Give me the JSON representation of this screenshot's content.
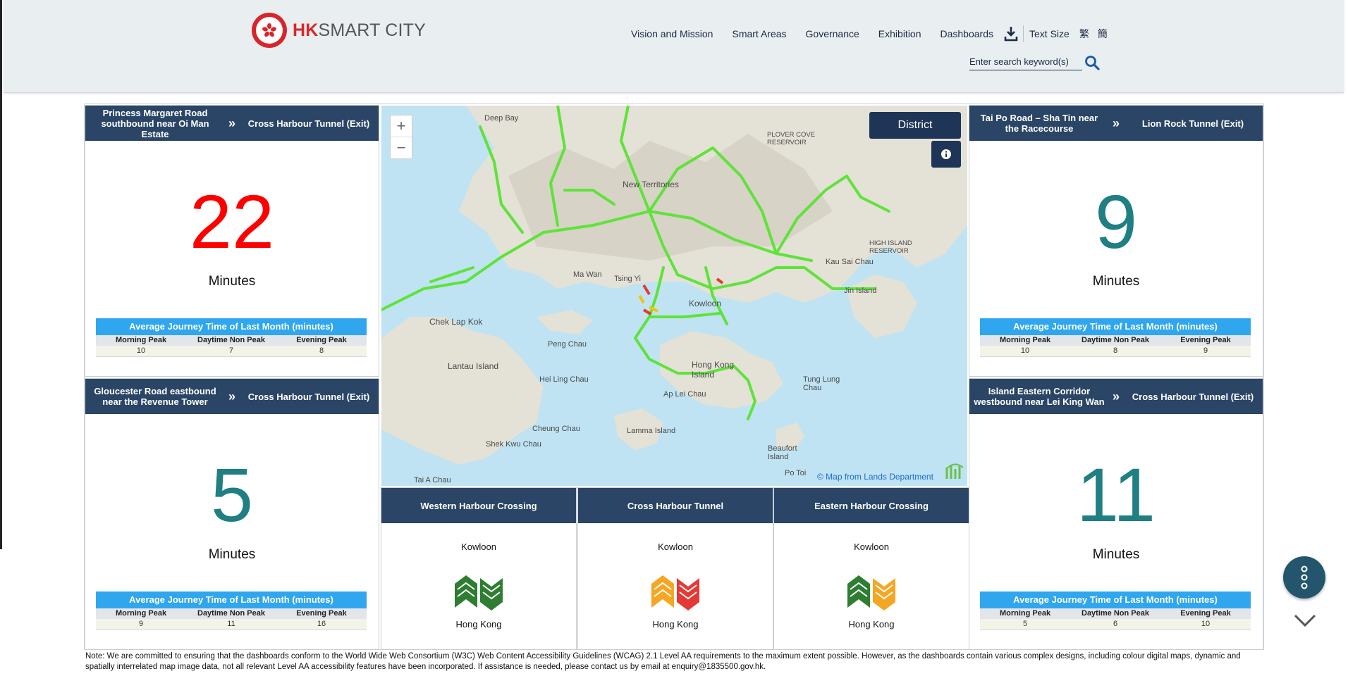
{
  "header": {
    "logo_hk": "HK",
    "logo_rest": "SMART CITY",
    "nav": [
      "Vision and Mission",
      "Smart Areas",
      "Governance",
      "Exhibition",
      "Dashboards"
    ],
    "text_size": "Text Size",
    "lang_trad": "繁",
    "lang_simp": "簡",
    "search_placeholder": "Enter search keyword(s)"
  },
  "avg_title": "Average Journey Time of Last Month (minutes)",
  "avg_cols": [
    "Morning Peak",
    "Daytime Non Peak",
    "Evening Peak"
  ],
  "minutes_label": "Minutes",
  "routes": [
    {
      "from": "Princess Margaret Road southbound near Oi Man Estate",
      "to": "Cross Harbour Tunnel (Exit)",
      "minutes": "22",
      "color": "#ff0000",
      "avg": [
        "10",
        "7",
        "8"
      ]
    },
    {
      "from": "Tai Po Road – Sha Tin near the Racecourse",
      "to": "Lion Rock Tunnel (Exit)",
      "minutes": "9",
      "color": "#1f7f82",
      "avg": [
        "10",
        "8",
        "9"
      ]
    },
    {
      "from": "Gloucester Road eastbound near the Revenue Tower",
      "to": "Cross Harbour Tunnel (Exit)",
      "minutes": "5",
      "color": "#1f7f82",
      "avg": [
        "9",
        "11",
        "16"
      ]
    },
    {
      "from": "Island Eastern Corridor westbound near Lei King Wan",
      "to": "Cross Harbour Tunnel (Exit)",
      "minutes": "11",
      "color": "#1f7f82",
      "avg": [
        "5",
        "6",
        "10"
      ]
    }
  ],
  "map": {
    "district_button": "District",
    "attribution": "© Map from Lands Department",
    "zoom_in": "+",
    "zoom_out": "−",
    "labels": {
      "deep_bay": "Deep Bay",
      "new_territories": "New Territories",
      "plover_cove": "PLOVER COVE RESERVOIR",
      "high_island": "HIGH ISLAND RESERVOIR",
      "kau_sai_chau": "Kau Sai Chau",
      "jin_island": "Jin Island",
      "ma_wan": "Ma Wan",
      "tsing_yi": "Tsing Yi",
      "kowloon": "Kowloon",
      "chek_lap_kok": "Chek Lap Kok",
      "peng_chau": "Peng Chau",
      "lantau": "Lantau Island",
      "hei_ling_chau": "Hei Ling Chau",
      "hong_kong_island": "Hong Kong Island",
      "tung_lung_chau": "Tung Lung Chau",
      "ap_lei_chau": "Ap Lei Chau",
      "cheung_chau": "Cheung Chau",
      "lamma": "Lamma Island",
      "shek_kwu_chau": "Shek Kwu Chau",
      "beaufort": "Beaufort Island",
      "po_toi": "Po Toi",
      "tai_a_chau": "Tai A Chau"
    }
  },
  "crossings": [
    {
      "name": "Western Harbour Crossing",
      "top": "Kowloon",
      "bottom": "Hong Kong",
      "left_color": "#2e7d32",
      "right_color": "#2e7d32"
    },
    {
      "name": "Cross Harbour Tunnel",
      "top": "Kowloon",
      "bottom": "Hong Kong",
      "left_color": "#f5a623",
      "right_color": "#e53935"
    },
    {
      "name": "Eastern Harbour Crossing",
      "top": "Kowloon",
      "bottom": "Hong Kong",
      "left_color": "#2e7d32",
      "right_color": "#f5a623"
    }
  ],
  "note": "Note: We are committed to ensuring that the dashboards conform to the World Wide Web Consortium (W3C) Web Content Accessibility Guidelines (WCAG) 2.1 Level AA requirements to the maximum extent possible. However, as the dashboards contain various complex designs, including colour digital maps, dynamic and spatially interrelated map image data, not all relevant Level AA accessibility features have been incorporated. If assistance is needed, please contact us by email at enquiry@1835500.gov.hk."
}
